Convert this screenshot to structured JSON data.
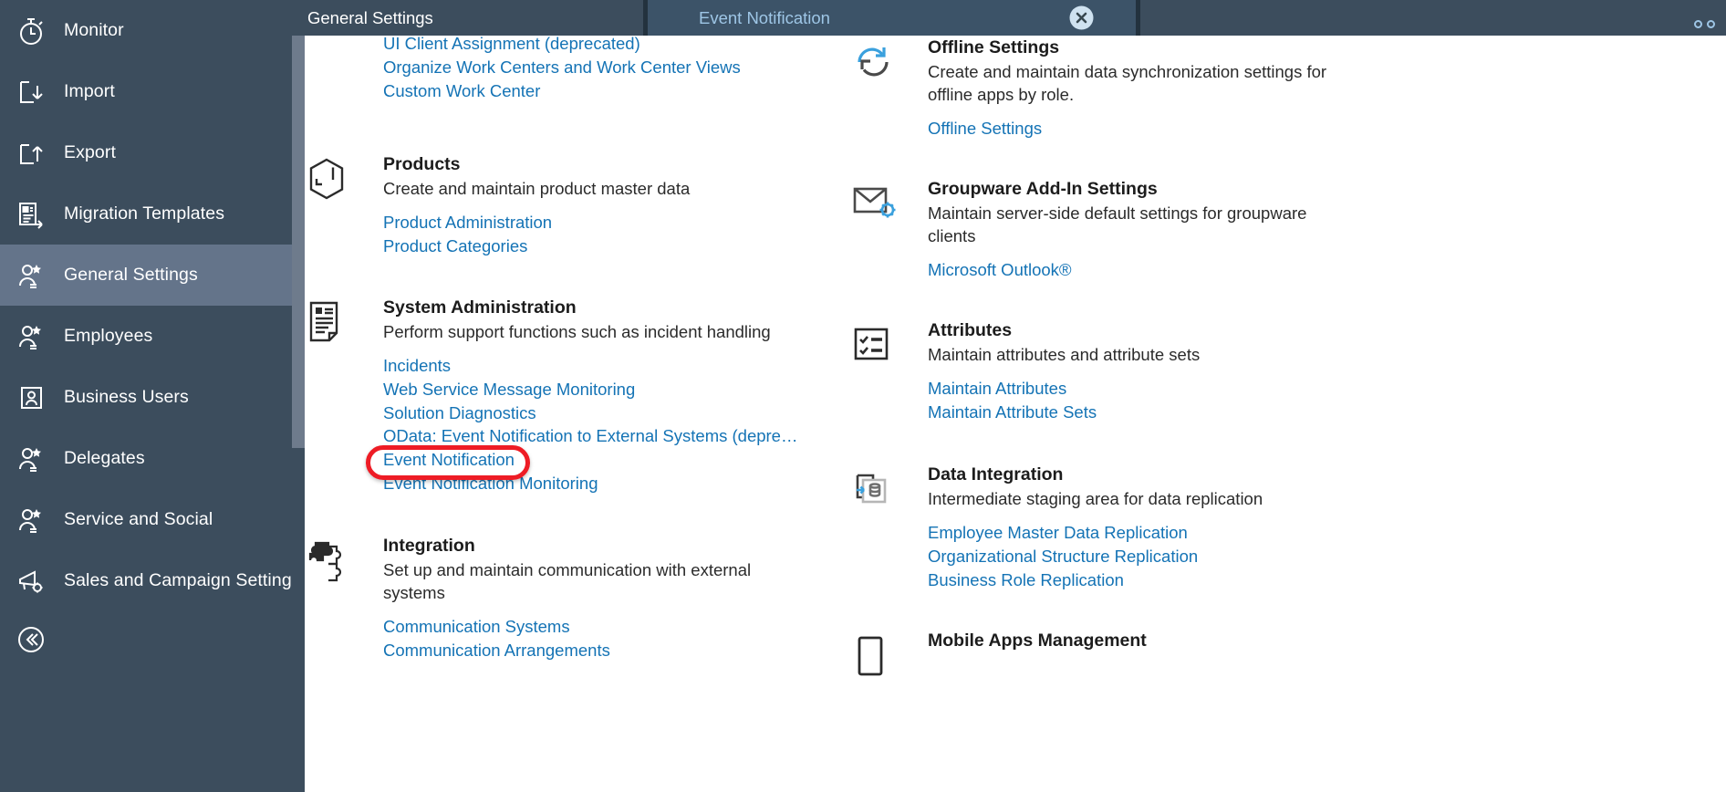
{
  "sidebar": {
    "items": [
      {
        "label": "Monitor",
        "icon": "stopwatch-icon",
        "active": false
      },
      {
        "label": "Import",
        "icon": "import-icon",
        "active": false
      },
      {
        "label": "Export",
        "icon": "export-icon",
        "active": false
      },
      {
        "label": "Migration Templates",
        "icon": "migration-templates-icon",
        "active": false
      },
      {
        "label": "General Settings",
        "icon": "user-star-icon",
        "active": true
      },
      {
        "label": "Employees",
        "icon": "user-star-icon",
        "active": false
      },
      {
        "label": "Business Users",
        "icon": "user-card-icon",
        "active": false
      },
      {
        "label": "Delegates",
        "icon": "user-star-icon",
        "active": false
      },
      {
        "label": "Service and Social",
        "icon": "user-star-icon",
        "active": false
      },
      {
        "label": "Sales and Campaign Settings",
        "icon": "megaphone-gear-icon",
        "active": false
      }
    ],
    "collapse_icon": "collapse-chevrons-icon"
  },
  "tabs": [
    {
      "label": "General Settings",
      "active": true,
      "closable": false
    },
    {
      "label": "Event Notification",
      "active": false,
      "closable": true,
      "close_icon": "close-circle-icon"
    }
  ],
  "tab_overflow_icon": "overflow-dots-icon",
  "content": {
    "left_column": [
      {
        "partial_top_links": [
          "UI Client Assignment (deprecated)",
          "Organize Work Centers and Work Center Views",
          "Custom Work Center"
        ]
      },
      {
        "icon": "product-box-icon",
        "title": "Products",
        "desc": "Create and maintain product master data",
        "links": [
          "Product Administration",
          "Product Categories"
        ]
      },
      {
        "icon": "system-admin-doc-icon",
        "title": "System Administration",
        "desc": "Perform support functions such as incident handling",
        "links": [
          "Incidents",
          "Web Service Message Monitoring",
          "Solution Diagnostics",
          "OData: Event Notification to External Systems (depre…",
          "Event Notification",
          "Event Notification Monitoring"
        ],
        "highlighted_link": "Event Notification"
      },
      {
        "icon": "puzzle-integration-icon",
        "title": "Integration",
        "desc": "Set up and maintain communication with external systems",
        "links": [
          "Communication Systems",
          "Communication Arrangements"
        ]
      }
    ],
    "right_column": [
      {
        "icon": "sync-refresh-icon",
        "title": "Offline Settings",
        "desc": "Create and maintain data synchronization settings for offline apps by role.",
        "links": [
          "Offline Settings"
        ]
      },
      {
        "icon": "mail-gear-icon",
        "title": "Groupware Add-In Settings",
        "desc": "Maintain server-side default settings for groupware clients",
        "links": [
          "Microsoft Outlook®"
        ]
      },
      {
        "icon": "checklist-icon",
        "title": "Attributes",
        "desc": "Maintain attributes and attribute sets",
        "links": [
          "Maintain Attributes",
          "Maintain Attribute Sets"
        ]
      },
      {
        "icon": "data-integration-icon",
        "title": "Data Integration",
        "desc": "Intermediate staging area for data replication",
        "links": [
          "Employee Master Data Replication",
          "Organizational Structure Replication",
          "Business Role Replication"
        ]
      },
      {
        "icon": "mobile-device-icon",
        "title": "Mobile Apps Management",
        "desc": "",
        "links": []
      }
    ]
  },
  "colors": {
    "sidebar_bg": "#3c4d5d",
    "sidebar_active": "#64748a",
    "tab_active_bg": "#3c5368",
    "link_blue": "#1473b5",
    "highlight_red": "#ee1c25",
    "accent_blue": "#3aa0dd"
  }
}
